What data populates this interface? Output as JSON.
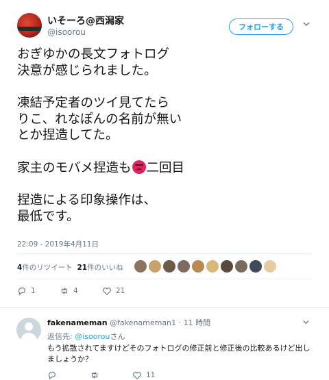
{
  "tweet": {
    "author_name": "いそーろ@西潟家",
    "author_handle": "@isoorou",
    "follow_label": "フォローする",
    "text_lines": [
      "おぎゆかの長文フォトログ",
      "決意が感じられました。",
      "",
      "凍結予定者のツイ見てたら",
      "りこ、れなぽんの名前が無い",
      "とか捏造してた。",
      "",
      "家主のモバメ捏造も",
      "",
      "捏造による印象操作は、",
      "最低です。"
    ],
    "line8_before": "家主のモバメ捏造も",
    "line8_after": "二回目",
    "emoji_icon": "angry-face-icon",
    "timestamp": "22:09 - 2019年4月11日",
    "retweet_count": "4",
    "retweet_label": "件のリツイート",
    "like_count": "21",
    "like_label": "件のいいね",
    "liker_colors": [
      "#8a7360",
      "#c9a26b",
      "#6d5a4a",
      "#7c6b5e",
      "#b88a52",
      "#d8b878",
      "#5a4a3e",
      "#7a6a5a",
      "#3e4a56",
      "#e8c9a0"
    ],
    "actions": {
      "reply_count": "1",
      "retweet_count": "4",
      "like_count": "21"
    }
  },
  "reply": {
    "name": "fakenameman",
    "handle": "@fakenameman1",
    "separator": "·",
    "time": "11 時間",
    "reply_to_label": "返信先:",
    "reply_to_handle": "@isoorou",
    "reply_to_suffix": "さん",
    "text": "もう拡散されてますけどそのフォトログの修正前と修正後の比較あるけど出しましょうか？",
    "actions": {
      "like_count": "11"
    }
  },
  "colors": {
    "accent": "#1da1f2",
    "muted": "#657786",
    "text": "#14171a"
  }
}
